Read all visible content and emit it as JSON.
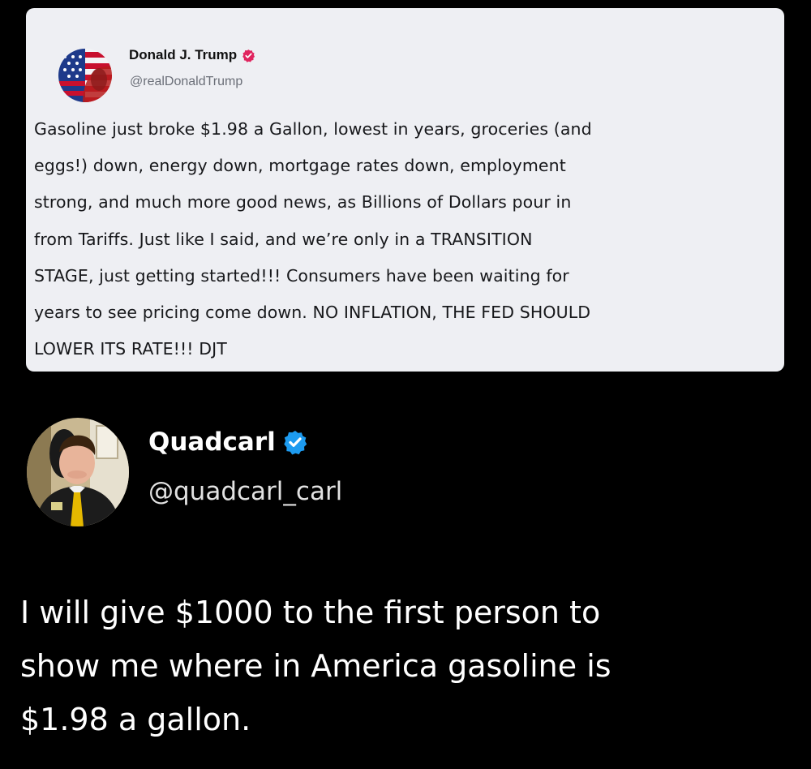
{
  "embedded_post": {
    "author_name": "Donald J. Trump",
    "author_handle": "@realDonaldTrump",
    "avatar_icon": "flag-portrait-avatar",
    "verified_icon": "verified-badge-icon",
    "verified_color": "#e0245e",
    "text_lines": [
      "Gasoline just broke $1.98 a Gallon, lowest in years, groceries (and",
      "eggs!) down, energy down, mortgage rates down, employment",
      "strong, and much more good news, as Billions of Dollars pour in",
      "from Tariffs. Just like I said, and we’re only in a TRANSITION",
      "STAGE, just getting started!!! Consumers have been waiting for",
      "years to see pricing come down. NO INFLATION, THE FED SHOULD",
      "LOWER ITS RATE!!! DJT"
    ]
  },
  "reply": {
    "author_name": "Quadcarl",
    "author_handle": "@quadcarl_carl",
    "avatar_icon": "user-photo-avatar",
    "verified_icon": "verified-badge-icon",
    "verified_color": "#1d9bf0",
    "text_lines": [
      "I will give $1000 to the first person to",
      "show me where in America gasoline is",
      "$1.98 a gallon."
    ]
  }
}
